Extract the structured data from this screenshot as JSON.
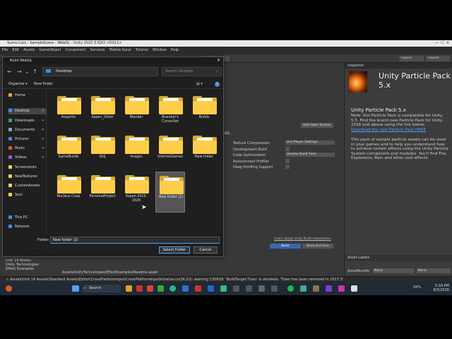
{
  "window": {
    "title": "Sumo-Cars - SampleScene - WebGL - Unity 2022.3.62f2 <DX11>"
  },
  "menu": [
    "File",
    "Edit",
    "Assets",
    "GameObject",
    "Component",
    "Services",
    "Mobile Input",
    "Tutorial",
    "Window",
    "Help"
  ],
  "toolbar": {
    "layers": "Layers",
    "layout": "Layout"
  },
  "dialog": {
    "title": "Build WebGL",
    "address": "Desktop",
    "search_placeholder": "Search Desktop",
    "organize": "Organize",
    "new_folder": "New folder",
    "nav": [
      {
        "label": "Home",
        "icon": "home-icon",
        "color": "#e8a23c"
      },
      {
        "label": "Desktop",
        "icon": "desktop-icon",
        "color": "#3a8ee6",
        "selected": true
      },
      {
        "label": "Downloads",
        "icon": "download-icon",
        "color": "#2fa86a"
      },
      {
        "label": "Documents",
        "icon": "document-icon",
        "color": "#8aa0b8"
      },
      {
        "label": "Pictures",
        "icon": "pictures-icon",
        "color": "#3a8ee6"
      },
      {
        "label": "Music",
        "icon": "music-icon",
        "color": "#e05a3a"
      },
      {
        "label": "Videos",
        "icon": "videos-icon",
        "color": "#8a5ae0"
      },
      {
        "label": "Screenshots",
        "icon": "folder-icon",
        "color": "#ffce49"
      },
      {
        "label": "NewTextures",
        "icon": "folder-icon",
        "color": "#ffce49"
      },
      {
        "label": "CustomAssets",
        "icon": "folder-icon",
        "color": "#ffce49"
      },
      {
        "label": "Soul",
        "icon": "folder-icon",
        "color": "#ffce49"
      },
      {
        "label": "This PC",
        "icon": "pc-icon",
        "color": "#3a8ee6"
      },
      {
        "label": "Network",
        "icon": "network-icon",
        "color": "#3a8ee6"
      }
    ],
    "folders": [
      {
        "label": "Aseprite"
      },
      {
        "label": "Aspen_Other"
      },
      {
        "label": "Blender"
      },
      {
        "label": "Brandon's CursorSet"
      },
      {
        "label": "Builds"
      },
      {
        "label": "GameBuilds"
      },
      {
        "label": "GGJ"
      },
      {
        "label": "Images"
      },
      {
        "label": "InternetGames"
      },
      {
        "label": "New folder"
      },
      {
        "label": "Nucleus Coop"
      },
      {
        "label": "PersonalProject"
      },
      {
        "label": "Aspen-2025-2026"
      },
      {
        "label": "New folder (2)",
        "selected": true
      }
    ],
    "folder_label": "Folder:",
    "folder_value": "New folder (2)",
    "select_button": "Select Folder",
    "cancel_button": "Cancel"
  },
  "build_settings": {
    "platform": "WebGL",
    "add_open_scenes": "Add Open Scenes",
    "rows": [
      {
        "label": "Texture Compression",
        "value": "Use Player Settings"
      },
      {
        "label": "Development Build",
        "value": ""
      },
      {
        "label": "Code Optimization",
        "value": "Shorter Build Time"
      },
      {
        "label": "Autoconnect Profiler",
        "value": ""
      },
      {
        "label": "Deep Profiling Support",
        "value": ""
      }
    ],
    "learn_link": "Learn about Unity Build Automation",
    "build_button": "Build",
    "build_and_run_button": "Build And Run"
  },
  "inspector": {
    "tab": "Inspector",
    "title": "Unity Particle Pack 5.x",
    "subtitle": "Unity Particle Pack 5.x",
    "note": "Note: this Particle Pack is compatible for Unity 5.5. Find the brand new Particle Pack for Unity 2018 and above using the link below:",
    "link": "Download the new Particle Pack HERE",
    "body": "This pack of sample particle assets can be used in your games and to help you understand how to achieve certain effects using the Unity Particle System component and modules. You'll find Fire, Explosions, Rain and other cool effects.",
    "asset_labels": "Asset Labels",
    "asset_bundle": "AssetBundle",
    "bundle_value": "None",
    "bundle_value2": "None"
  },
  "project_panel": {
    "items": [
      "Unit 14 Assets",
      "Unity Technologies",
      "Effect Examples"
    ],
    "path": "Assets/UnityTechnologies/EffectExamples/Readme.asset"
  },
  "status": "Assets\\Unit 14 Assets\\Standard Assets\\Editor\\CrossPlatformInput\\CrossPlatformInputInitialize.cs(36,22): warning CS0618: 'BuildTarget.Tizen' is obsolete: 'Tizen has been removed in 2017.3'",
  "taskbar": {
    "search": "Search",
    "time": "5:18 PM",
    "date": "8/3/2026",
    "battery": "94%"
  }
}
